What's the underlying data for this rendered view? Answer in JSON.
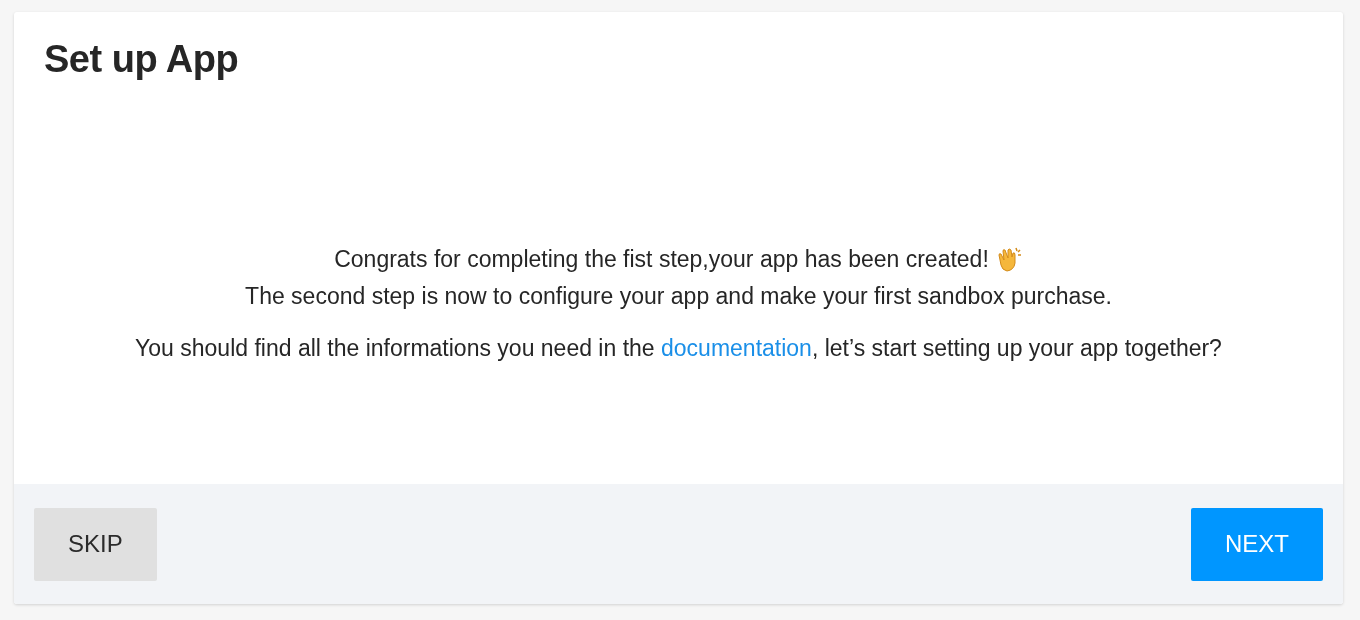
{
  "dialog": {
    "title": "Set up App",
    "message_lines": [
      "Congrats for completing the fist step,your app has been created!",
      "The second step is now to configure your app and make your first sandbox purchase."
    ],
    "help_text": {
      "before": "You should find all the informations you need in the ",
      "link": "documentation",
      "after": ", let’s start setting up your app together?"
    },
    "buttons": [
      {
        "label": "SKIP",
        "kind": "secondary"
      },
      {
        "label": "NEXT",
        "kind": "primary"
      }
    ]
  }
}
